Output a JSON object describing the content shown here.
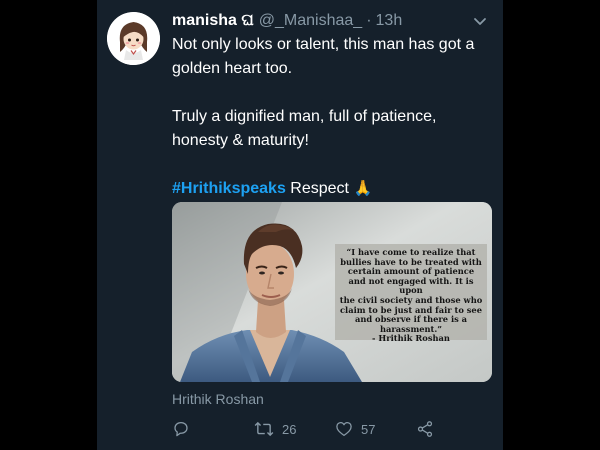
{
  "tweet": {
    "author": {
      "display_name": "manisha ଘ",
      "handle": "@_Manishaa_",
      "avatar_icon": "cartoon-girl-avatar"
    },
    "separator": "·",
    "timestamp": "13h",
    "text": {
      "line1": "Not only looks or talent, this man has got a golden heart too.",
      "line2": "Truly a dignified man, full of patience, honesty & maturity!",
      "hashtag": "#Hrithikspeaks",
      "line3_rest": " Respect ",
      "emoji": "🙏"
    },
    "media": {
      "quote_lines": [
        "“I have come to realize that",
        "bullies have to be treated with",
        "certain amount of patience",
        "and not engaged with. It is upon",
        "the civil society and those who",
        "claim to be just and fair to see",
        "and observe if there is a",
        "harassment.”",
        "- Hrithik Roshan"
      ],
      "caption": "Hrithik Roshan"
    },
    "actions": {
      "retweet_count": "26",
      "like_count": "57"
    },
    "colors": {
      "background": "#15202b",
      "text": "#ffffff",
      "secondary": "#8899a6",
      "hashtag": "#1da1f2"
    }
  }
}
